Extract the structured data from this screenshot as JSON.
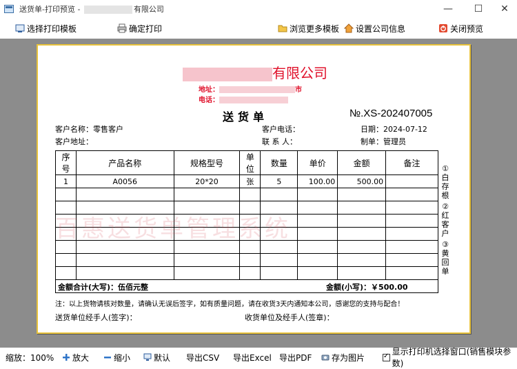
{
  "window": {
    "title_prefix": "送货单-打印预览 - ",
    "title_suffix": "有限公司",
    "minimize": "—",
    "maximize": "☐",
    "close": "✕"
  },
  "toolbar": {
    "select_template": "选择打印模板",
    "confirm_print": "确定打印",
    "browse_templates": "浏览更多模板",
    "company_info": "设置公司信息",
    "close_preview": "关闭预览"
  },
  "document": {
    "company_suffix": "有限公司",
    "address_label": "地址：",
    "address_tail": "市",
    "phone_label": "电话：",
    "title": "送货单",
    "number": "№.XS-202407005",
    "customer_name": "客户名称：零售客户",
    "customer_phone": "客户电话：",
    "date": "日期：2024-07-12",
    "customer_address": "客户地址：",
    "contact": "联 系 人：",
    "maker": "制单：管理员",
    "watermark": "百惠送货单管理系统",
    "columns": [
      "序号",
      "产品名称",
      "规格型号",
      "单位",
      "数量",
      "单价",
      "金额",
      "备注"
    ],
    "rows": [
      [
        "1",
        "A0056",
        "20*20",
        "张",
        "5",
        "100.00",
        "500.00",
        ""
      ],
      [
        "",
        "",
        "",
        "",
        "",
        "",
        "",
        ""
      ],
      [
        "",
        "",
        "",
        "",
        "",
        "",
        "",
        ""
      ],
      [
        "",
        "",
        "",
        "",
        "",
        "",
        "",
        ""
      ],
      [
        "",
        "",
        "",
        "",
        "",
        "",
        "",
        ""
      ],
      [
        "",
        "",
        "",
        "",
        "",
        "",
        "",
        ""
      ],
      [
        "",
        "",
        "",
        "",
        "",
        "",
        "",
        ""
      ],
      [
        "",
        "",
        "",
        "",
        "",
        "",
        "",
        ""
      ]
    ],
    "total_upper": "金额合计(大写)：伍佰元整",
    "total_lower": "金额(小写)：￥500.00",
    "note": "注：以上货物请核对数量，请确认无误后签字，如有质量问题，请在收货3天内通知本公司，感谢您的支持与配合！",
    "sender_sign": "送货单位经手人(签字)：",
    "receiver_sign": "收货单位及经手人(签章)：",
    "stubs": [
      "①白存根",
      "②红客户",
      "③黄回单"
    ]
  },
  "statusbar": {
    "zoom": "缩放：100%",
    "zoom_in": "放大",
    "zoom_out": "缩小",
    "default": "默认",
    "export_csv": "导出CSV",
    "export_excel": "导出Excel",
    "export_pdf": "导出PDF",
    "save_image": "存为图片",
    "show_printer": "显示打印机选择窗口(销售模块参数)"
  },
  "colors": {
    "accent_red": "#e0102a",
    "preview_bg": "#8c8c8c",
    "paper_border": "#e8c23a"
  }
}
